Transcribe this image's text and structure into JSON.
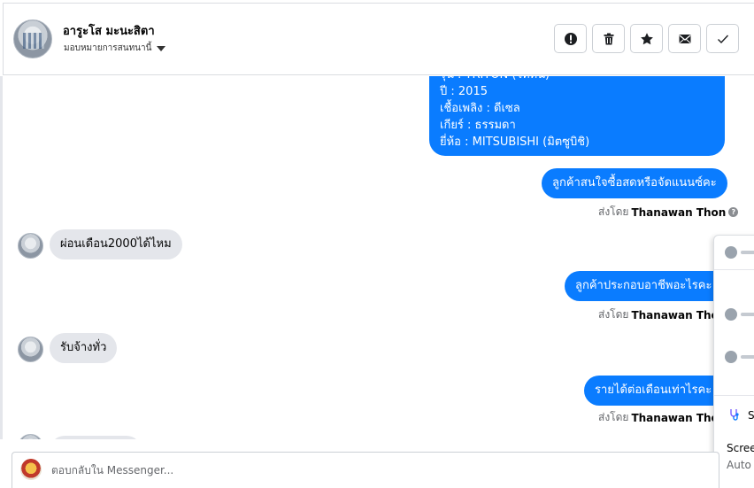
{
  "header": {
    "contact_name": "อารูะโส มะนะสิตา",
    "assign_label": "มอบหมายการสนทนานี้",
    "actions": [
      {
        "name": "report-button",
        "icon": "alert-circle-icon"
      },
      {
        "name": "delete-button",
        "icon": "trash-icon"
      },
      {
        "name": "star-button",
        "icon": "star-icon"
      },
      {
        "name": "mark-unread-button",
        "icon": "envelope-icon"
      },
      {
        "name": "mark-done-button",
        "icon": "check-icon"
      }
    ]
  },
  "messages": {
    "car_details": {
      "line1": "รุ่น : TRITON (ไททัน)",
      "line2": "ปี : 2015",
      "line3": "เชื้อเพลิง : ดีเซล",
      "line4": "เกียร์ : ธรรมดา",
      "line5": "ยี่ห้อ : MITSUBISHI (มิตซูบิชิ)"
    },
    "out1": "ลูกค้าสนใจซื้อสดหรือจัดแนนซ์คะ",
    "in1": "ผ่อนเดือน2000ได้ไหม",
    "out2": "ลูกค้าประกอบอาชีพอะไรคะ",
    "in2": "รับจ้างทั่ว",
    "out3": "รายได้ต่อเดือนเท่าไรคะ",
    "sent_by_prefix": "ส่งโดย",
    "sent_by_name": "Thanawan Thon"
  },
  "overlay": {
    "item_short": "S",
    "screen_label": "Scree",
    "auto_label": "Auto"
  },
  "composer": {
    "placeholder": "ตอบกลับใน Messenger..."
  },
  "colors": {
    "outgoing_bubble": "#0a7cff",
    "incoming_bubble": "#e4e6eb"
  }
}
